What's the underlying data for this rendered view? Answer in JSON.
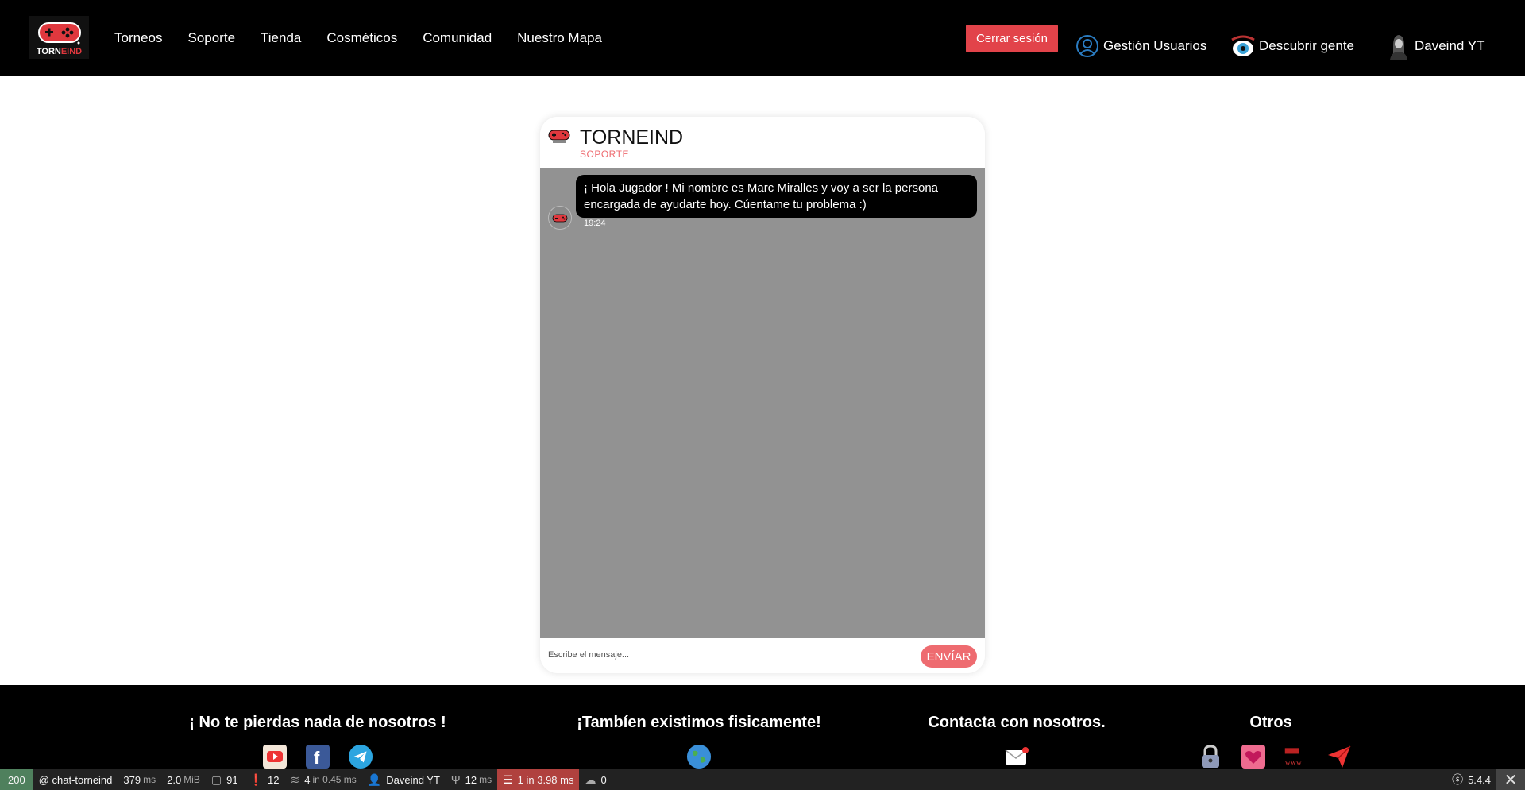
{
  "nav": {
    "logo_text_1": "TORN",
    "logo_text_2": "EIND",
    "links": [
      "Torneos",
      "Soporte",
      "Tienda",
      "Cosméticos",
      "Comunidad",
      "Nuestro Mapa"
    ],
    "logout_label": "Cerrar sesión",
    "users_label": "Gestión Usuarios",
    "discover_label": "Descubrir gente",
    "profile_label": "Daveind YT"
  },
  "chat": {
    "title": "TORNEIND",
    "subtitle": "SOPORTE",
    "message": "¡ Hola Jugador ! Mi nombre es Marc Miralles y voy a ser la persona encargada de ayudarte hoy. Cúentame tu problema :)",
    "time": "19:24",
    "input_placeholder": "Escribe el mensaje...",
    "send_label": "ENVÍAR"
  },
  "footer": {
    "col1_title": "¡ No te pierdas nada de nosotros !",
    "col2_title": "¡Tambíen existimos fisicamente!",
    "col3_title": "Contacta con nosotros.",
    "col4_title": "Otros"
  },
  "debug": {
    "status": "200",
    "route": "@ chat-torneind",
    "time_value": "379",
    "time_unit": "ms",
    "memory_value": "2.0",
    "memory_unit": "MiB",
    "forms": "91",
    "logs": "12",
    "cache_value": "4",
    "cache_detail": "in 0.45 ms",
    "user": "Daveind YT",
    "twig_value": "12",
    "twig_unit": "ms",
    "db_value": "1 in 3.98 ms",
    "ajax": "0",
    "version": "5.4.4"
  },
  "colors": {
    "accent": "#e2434a",
    "pink": "#ee6b70",
    "chat_bg": "#929292"
  }
}
